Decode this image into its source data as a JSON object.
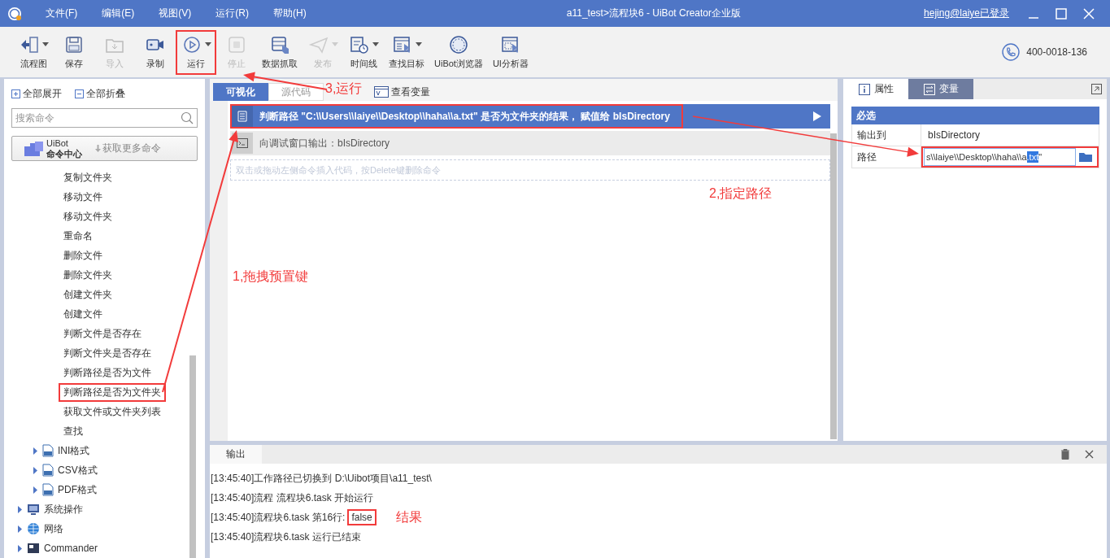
{
  "window": {
    "title": "a11_test>流程块6 - UiBot Creator企业版",
    "user": "hejing@laiye已登录"
  },
  "menu": [
    "文件(F)",
    "编辑(E)",
    "视图(V)",
    "运行(R)",
    "帮助(H)"
  ],
  "toolbar": [
    {
      "label": "流程图",
      "disabled": false,
      "dropdown": true,
      "marked": false
    },
    {
      "label": "保存",
      "disabled": false,
      "dropdown": false,
      "marked": false
    },
    {
      "label": "导入",
      "disabled": true,
      "dropdown": false,
      "marked": false
    },
    {
      "label": "录制",
      "disabled": false,
      "dropdown": false,
      "marked": false
    },
    {
      "label": "运行",
      "disabled": false,
      "dropdown": true,
      "marked": true
    },
    {
      "label": "停止",
      "disabled": true,
      "dropdown": false,
      "marked": false
    },
    {
      "label": "数据抓取",
      "disabled": false,
      "dropdown": false,
      "marked": false
    },
    {
      "label": "发布",
      "disabled": true,
      "dropdown": true,
      "marked": false
    },
    {
      "label": "时间线",
      "disabled": false,
      "dropdown": true,
      "marked": false
    },
    {
      "label": "查找目标",
      "disabled": false,
      "dropdown": true,
      "marked": false
    },
    {
      "label": "UiBot浏览器",
      "disabled": false,
      "dropdown": false,
      "marked": false
    },
    {
      "label": "UI分析器",
      "disabled": false,
      "dropdown": false,
      "marked": false
    }
  ],
  "phone": "400-0018-136",
  "sidebar": {
    "expand_all": "全部展开",
    "collapse_all": "全部折叠",
    "search": {
      "placeholder": "搜索命令"
    },
    "command_center": {
      "title": "UiBot",
      "subtitle": "命令中心",
      "action": "获取更多命令"
    },
    "items": [
      {
        "kind": "command",
        "label": "复制文件夹",
        "marked": false
      },
      {
        "kind": "command",
        "label": "移动文件",
        "marked": false
      },
      {
        "kind": "command",
        "label": "移动文件夹",
        "marked": false
      },
      {
        "kind": "command",
        "label": "重命名",
        "marked": false
      },
      {
        "kind": "command",
        "label": "删除文件",
        "marked": false
      },
      {
        "kind": "command",
        "label": "删除文件夹",
        "marked": false
      },
      {
        "kind": "command",
        "label": "创建文件夹",
        "marked": false
      },
      {
        "kind": "command",
        "label": "创建文件",
        "marked": false
      },
      {
        "kind": "command",
        "label": "判断文件是否存在",
        "marked": false
      },
      {
        "kind": "command",
        "label": "判断文件夹是否存在",
        "marked": false
      },
      {
        "kind": "command",
        "label": "判断路径是否为文件",
        "marked": false
      },
      {
        "kind": "command",
        "label": "判断路径是否为文件夹",
        "marked": true
      },
      {
        "kind": "command",
        "label": "获取文件或文件夹列表",
        "marked": false
      },
      {
        "kind": "command",
        "label": "查找",
        "marked": false
      },
      {
        "kind": "group",
        "label": "INI格式",
        "expanded": false
      },
      {
        "kind": "group",
        "label": "CSV格式",
        "expanded": false
      },
      {
        "kind": "group",
        "label": "PDF格式",
        "expanded": false
      },
      {
        "kind": "category",
        "label": "系统操作",
        "expanded": false
      },
      {
        "kind": "category",
        "label": "网络",
        "expanded": false
      },
      {
        "kind": "category",
        "label": "Commander",
        "expanded": false
      }
    ]
  },
  "editor": {
    "tabs": [
      {
        "label": "可视化",
        "selected": true
      },
      {
        "label": "源代码",
        "selected": false
      }
    ],
    "view_variables": "查看变量",
    "commands": [
      {
        "kind": "file",
        "text": "判断路径 \"C:\\\\Users\\\\laiye\\\\Desktop\\\\haha\\\\a.txt\" 是否为文件夹的结果， 赋值给 bIsDirectory",
        "selected": true,
        "marked": true
      },
      {
        "kind": "print",
        "text": "向调试窗口输出：bIsDirectory",
        "selected": false,
        "marked": false
      }
    ],
    "placeholder": "双击或拖动左侧命令插入代码，按Delete键删除命令"
  },
  "properties": {
    "tabs": [
      {
        "label": "属性",
        "selected": true
      },
      {
        "label": "变量",
        "selected": false
      }
    ],
    "section": "必选",
    "rows": [
      {
        "kind": "text",
        "label": "输出到",
        "value": "bIsDirectory"
      },
      {
        "kind": "path",
        "label": "路径",
        "text_before": "s\\\\laiye\\\\Desktop\\\\haha\\\\a",
        "selected_text": ".txt",
        "text_after": "\"",
        "marked": true
      }
    ]
  },
  "output": {
    "tab": "输出",
    "lines": [
      {
        "text": "[13:45:40]工作路径已切换到 D:\\Uibot项目\\a11_test\\"
      },
      {
        "text": "[13:45:40]流程 流程块6.task 开始运行"
      },
      {
        "text": "[13:45:40]流程块6.task 第16行:",
        "result": "false"
      },
      {
        "text": "[13:45:40]流程块6.task 运行已结束"
      }
    ]
  },
  "annotations": [
    {
      "text": "3,运行"
    },
    {
      "text": "2,指定路径"
    },
    {
      "text": "1,拖拽预置键"
    },
    {
      "text": "结果"
    }
  ]
}
